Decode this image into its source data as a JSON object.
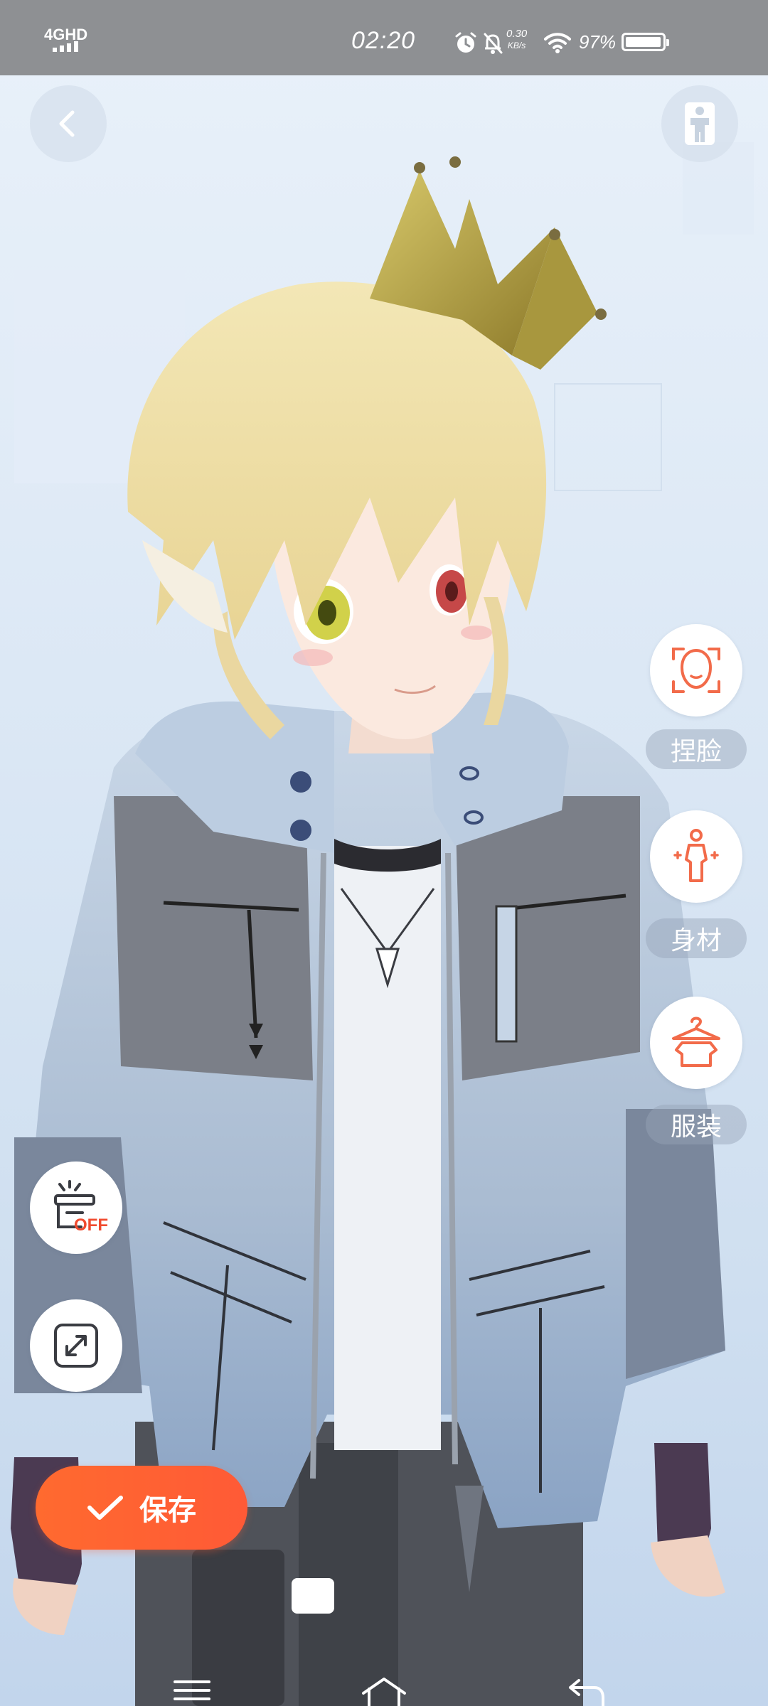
{
  "status_bar": {
    "network": "4GHD",
    "time": "02:20",
    "net_speed_value": "0.30",
    "net_speed_unit": "KB/s",
    "battery": "97%",
    "battery_level": 0.97,
    "icons": [
      "alarm-icon",
      "bell-off-icon",
      "wifi-icon",
      "battery-icon"
    ]
  },
  "top_controls": {
    "back_icon": "chevron-left-icon",
    "pose_icon": "body-pose-icon"
  },
  "side_menu": [
    {
      "id": "face",
      "label": "捏脸",
      "icon": "face-icon"
    },
    {
      "id": "body",
      "label": "身材",
      "icon": "body-icon"
    },
    {
      "id": "outfit",
      "label": "服装",
      "icon": "hanger-shirt-icon"
    }
  ],
  "left_controls": {
    "toggle_badge": "OFF",
    "toggle_icon": "box-off-icon",
    "fullscreen_icon": "expand-icon"
  },
  "save_button": {
    "label": "保存",
    "icon": "check-icon"
  },
  "nav_bar": {
    "icons": [
      "menu-icon",
      "home-icon",
      "back-icon"
    ]
  },
  "colors": {
    "accent": "#ff5a36",
    "icon_accent": "#f26b4a",
    "status_bar_bg": "#8e9093",
    "background": "#dce8f5"
  }
}
